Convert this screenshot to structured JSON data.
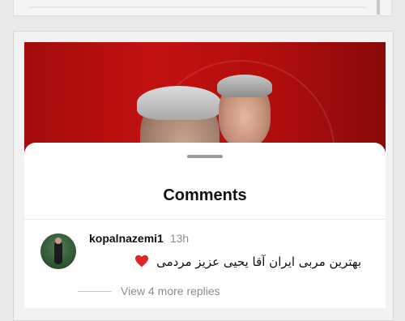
{
  "post": {
    "media_alt": "Photo of two men on a red background"
  },
  "comments_sheet": {
    "title": "Comments",
    "comments": [
      {
        "username": "kopalnazemi1",
        "timestamp": "13h",
        "text": "بهترین مربی ایران آقا یحیی عزیز مردمی",
        "reaction_icon": "heart-icon",
        "view_replies_label": "View 4 more replies"
      }
    ]
  },
  "colors": {
    "media_red": "#c31111",
    "heart_red": "#e0242a",
    "secondary_text": "#8e8e8e"
  }
}
